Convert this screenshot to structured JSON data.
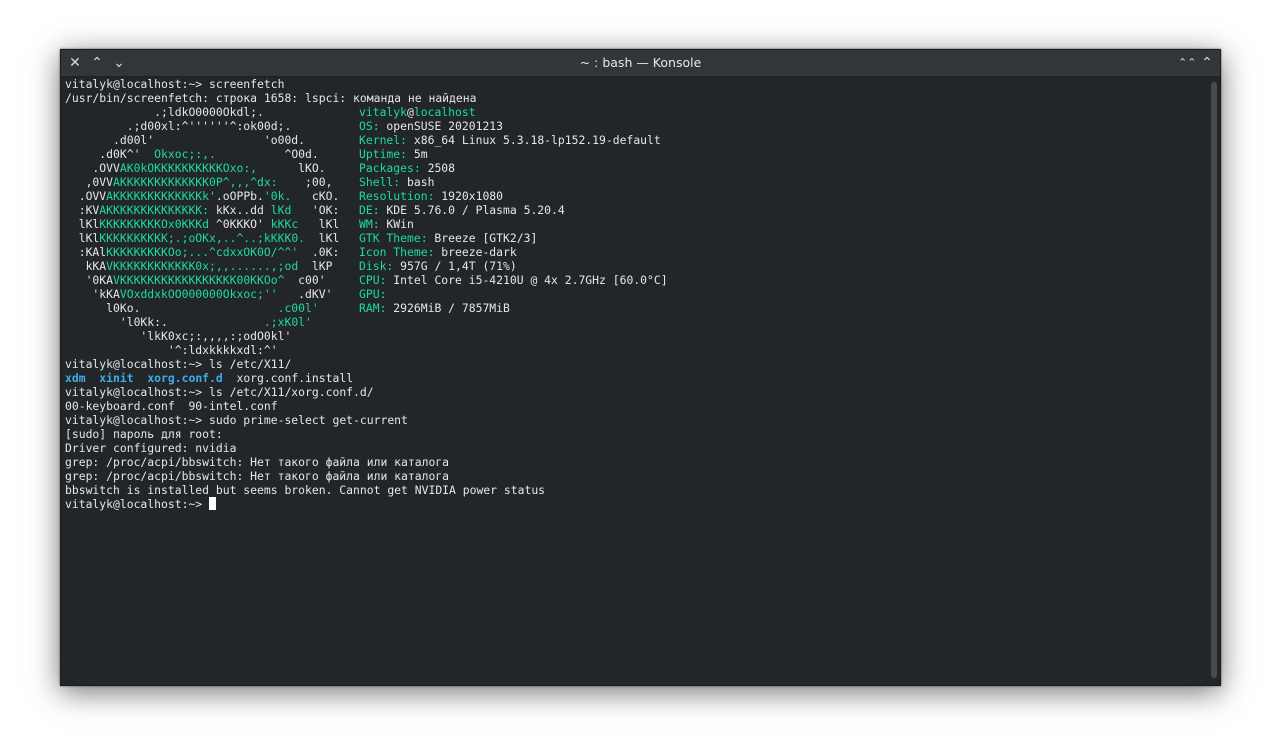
{
  "window": {
    "title": "~ : bash — Konsole",
    "buttons": {
      "close": "✕",
      "up": "⌃",
      "down": "⌄",
      "keep_above": "⌃⌃",
      "maximize": "⌃"
    }
  },
  "terminal": {
    "prompt": "vitalyk@localhost:~> ",
    "cmd1": "screenfetch",
    "err1": "/usr/bin/screenfetch: строка 1658: lspci: команда не найдена",
    "logo": [
      [
        "             .;ldkO0000Okdl;.",
        ""
      ],
      [
        "         .;d00xl:^''''''^:ok00d;.",
        ""
      ],
      [
        "       .d00l'                'o00d.",
        ""
      ],
      [
        "     .d0K^'  ",
        "Okxoc;:,.",
        "          ^O0d."
      ],
      [
        "    .OVV",
        "AK0kOKKKKKKKKKKOxo:,",
        "      lKO."
      ],
      [
        "   ,0VV",
        "AKKKKKKKKKKKKK0P^,,,^dx:",
        "    ;00,"
      ],
      [
        "  .OVV",
        "AKKKKKKKKKKKKKk'",
        ".oOPPb.",
        "'0k.",
        "   cKO."
      ],
      [
        "  :KV",
        "AKKKKKKKKKKKKKK:",
        " kKx..dd ",
        "lKd",
        "   'OK:"
      ],
      [
        "  lKl",
        "KKKKKKKKKOx0KKKd",
        " ^0KKKO' ",
        "kKKc",
        "   lKl"
      ],
      [
        "  lKl",
        "KKKKKKKKKK;.;oOKx,..^..;kKKK0.",
        "  lKl"
      ],
      [
        "  :KAl",
        "KKKKKKKKKOo;...^cdxxOK0O/^^'",
        "  .0K:"
      ],
      [
        "   kKA",
        "VKKKKKKKKKKKK0x;,,......,;od",
        "  lKP"
      ],
      [
        "   '0KA",
        "VKKKKKKKKKKKKKKKKK00KKOo^",
        "  c00'"
      ],
      [
        "    'kKA",
        "VOxddxkOO000000Okxoc;''",
        "   .dKV'"
      ],
      [
        "      l0Ko.",
        "                    .c00l'",
        ""
      ],
      [
        "        'l0Kk:.",
        "              .;xK0l'",
        ""
      ],
      [
        "           'lkK0xc;:,,,,:;odO0kl'",
        ""
      ],
      [
        "               '^:ldxkkkkxdl:^'",
        ""
      ]
    ],
    "info": [
      {
        "key": "",
        "user": "vitalyk",
        "at": "@",
        "host": "localhost"
      },
      {
        "key": "OS:",
        "value": " openSUSE 20201213"
      },
      {
        "key": "Kernel:",
        "value": " x86_64 Linux 5.3.18-lp152.19-default"
      },
      {
        "key": "Uptime:",
        "value": " 5m"
      },
      {
        "key": "Packages:",
        "value": " 2508"
      },
      {
        "key": "Shell:",
        "value": " bash"
      },
      {
        "key": "Resolution:",
        "value": " 1920x1080"
      },
      {
        "key": "DE:",
        "value": " KDE 5.76.0 / Plasma 5.20.4"
      },
      {
        "key": "WM:",
        "value": " KWin"
      },
      {
        "key": "GTK Theme:",
        "value": " Breeze [GTK2/3]"
      },
      {
        "key": "Icon Theme:",
        "value": " breeze-dark"
      },
      {
        "key": "Disk:",
        "value": " 957G / 1,4T (71%)"
      },
      {
        "key": "CPU:",
        "value": " Intel Core i5-4210U @ 4x 2.7GHz [60.0°C]"
      },
      {
        "key": "GPU:",
        "value": ""
      },
      {
        "key": "RAM:",
        "value": " 2926MiB / 7857MiB"
      }
    ],
    "cmd2": "ls /etc/X11/",
    "ls1": {
      "d1": "xdm",
      "d2": "xinit",
      "d3": "xorg.conf.d",
      "f1": "xorg.conf.install"
    },
    "cmd3": "ls /etc/X11/xorg.conf.d/",
    "ls2": "00-keyboard.conf  90-intel.conf",
    "cmd4": "sudo prime-select get-current",
    "out": [
      "[sudo] пароль для root:",
      "Driver configured: nvidia",
      "grep: /proc/acpi/bbswitch: Нет такого файла или каталога",
      "grep: /proc/acpi/bbswitch: Нет такого файла или каталога",
      "bbswitch is installed but seems broken. Cannot get NVIDIA power status"
    ]
  }
}
